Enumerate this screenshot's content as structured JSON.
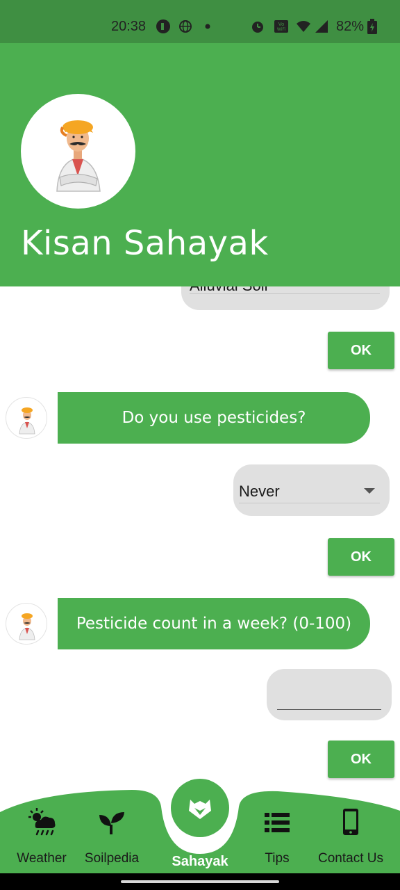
{
  "status_bar": {
    "time": "20:38",
    "battery": "82%"
  },
  "header": {
    "title": "Kisan Sahayak",
    "accent_color": "#4caf50"
  },
  "chat": {
    "soil_select": {
      "value": "Alluvial Soil"
    },
    "ok_label": "OK",
    "messages": [
      {
        "text": "Do you use pesticides?"
      },
      {
        "text": "Pesticide count in a week? (0-100)"
      }
    ],
    "pesticide_select": {
      "value": "Never"
    },
    "count_input": {
      "value": "",
      "placeholder": ""
    }
  },
  "bottom_nav": {
    "items": [
      {
        "label": "Weather",
        "icon": "weather-icon"
      },
      {
        "label": "Soilpedia",
        "icon": "sprout-icon"
      },
      {
        "label": "Sahayak",
        "icon": "sahayak-logo-icon"
      },
      {
        "label": "Tips",
        "icon": "list-icon"
      },
      {
        "label": "Contact Us",
        "icon": "phone-icon"
      }
    ]
  }
}
